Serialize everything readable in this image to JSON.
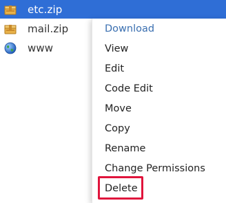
{
  "files": [
    {
      "name": "etc.zip",
      "icon": "archive-icon",
      "selected": true
    },
    {
      "name": "mail.zip",
      "icon": "archive-icon",
      "selected": false
    },
    {
      "name": "www",
      "icon": "globe-icon",
      "selected": false
    }
  ],
  "context_menu": {
    "items": [
      {
        "label": "Download"
      },
      {
        "label": "View"
      },
      {
        "label": "Edit"
      },
      {
        "label": "Code Edit"
      },
      {
        "label": "Move"
      },
      {
        "label": "Copy"
      },
      {
        "label": "Rename"
      },
      {
        "label": "Change Permissions"
      },
      {
        "label": "Delete"
      }
    ]
  },
  "colors": {
    "selection": "#2f6ed6",
    "highlight_box": "#e0143c",
    "download_link": "#3a6fb0"
  }
}
